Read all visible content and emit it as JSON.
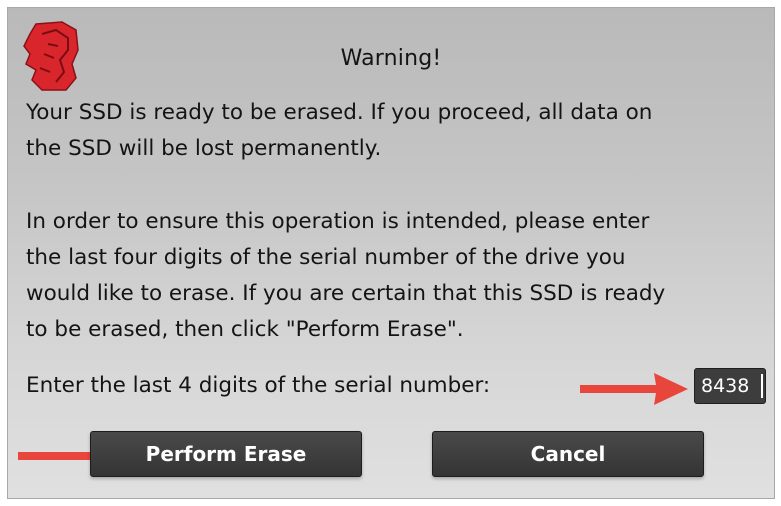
{
  "dialog": {
    "logo_icon": "kingston-red-head-logo",
    "title": "Warning!",
    "message_line1": "Your SSD is ready to be erased.  If you proceed, all data on",
    "message_line2": "the SSD will be lost permanently.",
    "instruction_line1": "In order to ensure this operation is intended, please enter",
    "instruction_line2": "the last four digits of the serial number of the drive you",
    "instruction_line3": "would like to erase.  If you are certain that this SSD is ready",
    "instruction_line4": "to be erased, then click \"Perform Erase\".",
    "serial_prompt": "Enter the last 4 digits of the serial number:",
    "serial_value": "8438",
    "perform_erase_label": "Perform Erase",
    "cancel_label": "Cancel"
  },
  "annotations": {
    "arrow_icon": "red-arrow-right-icon",
    "arrow_color": "#e8463c"
  },
  "colors": {
    "button_bg": "#3a3a3a",
    "button_text": "#ffffff",
    "logo_red": "#d9262c"
  }
}
